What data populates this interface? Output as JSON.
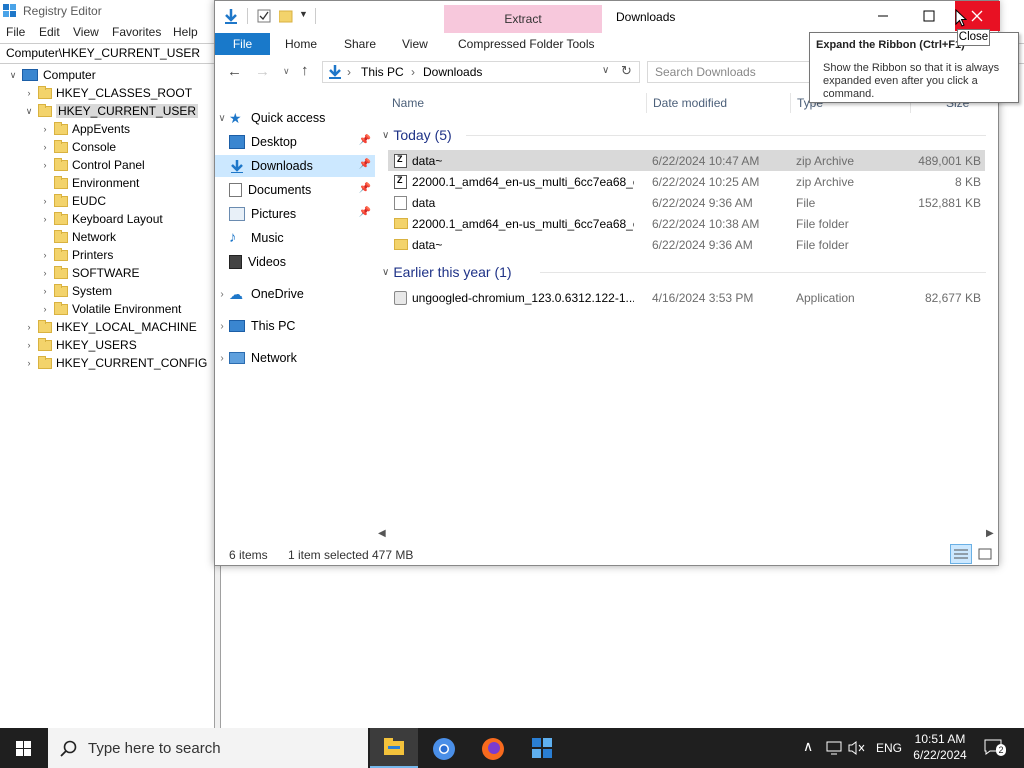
{
  "regedit": {
    "title": "Registry Editor",
    "menu": [
      "File",
      "Edit",
      "View",
      "Favorites",
      "Help"
    ],
    "address": "Computer\\HKEY_CURRENT_USER",
    "tree": {
      "computer": "Computer",
      "hkcr": "HKEY_CLASSES_ROOT",
      "hkcu": "HKEY_CURRENT_USER",
      "hkcu_children": [
        "AppEvents",
        "Console",
        "Control Panel",
        "Environment",
        "EUDC",
        "Keyboard Layout",
        "Network",
        "Printers",
        "SOFTWARE",
        "System",
        "Volatile Environment"
      ],
      "hklm": "HKEY_LOCAL_MACHINE",
      "hku": "HKEY_USERS",
      "hkcc": "HKEY_CURRENT_CONFIG"
    }
  },
  "explorer": {
    "window_title": "Downloads",
    "contextual_tab": "Extract",
    "ribbon_tabs": {
      "file": "File",
      "home": "Home",
      "share": "Share",
      "view": "View",
      "compressed": "Compressed Folder Tools"
    },
    "breadcrumb": [
      "This PC",
      "Downloads"
    ],
    "search_placeholder": "Search Downloads",
    "nav": {
      "quick_access": "Quick access",
      "desktop": "Desktop",
      "downloads": "Downloads",
      "documents": "Documents",
      "pictures": "Pictures",
      "music": "Music",
      "videos": "Videos",
      "onedrive": "OneDrive",
      "this_pc": "This PC",
      "network": "Network"
    },
    "columns": {
      "name": "Name",
      "date": "Date modified",
      "type": "Type",
      "size": "Size"
    },
    "groups": {
      "today": "Today (5)",
      "earlier": "Earlier this year (1)"
    },
    "files_today": [
      {
        "name": "data~",
        "date": "6/22/2024 10:47 AM",
        "type": "zip Archive",
        "size": "489,001 KB",
        "icon": "zip-icon"
      },
      {
        "name": "22000.1_amd64_en-us_multi_6cc7ea68_c...",
        "date": "6/22/2024 10:25 AM",
        "type": "zip Archive",
        "size": "8 KB",
        "icon": "zip-icon"
      },
      {
        "name": "data",
        "date": "6/22/2024 9:36 AM",
        "type": "File",
        "size": "152,881 KB",
        "icon": "file-icon"
      },
      {
        "name": "22000.1_amd64_en-us_multi_6cc7ea68_c...",
        "date": "6/22/2024 10:38 AM",
        "type": "File folder",
        "size": "",
        "icon": "folder-icon"
      },
      {
        "name": "data~",
        "date": "6/22/2024 9:36 AM",
        "type": "File folder",
        "size": "",
        "icon": "folder-icon"
      }
    ],
    "files_earlier": [
      {
        "name": "ungoogled-chromium_123.0.6312.122-1....",
        "date": "4/16/2024 3:53 PM",
        "type": "Application",
        "size": "82,677 KB",
        "icon": "app-icon"
      }
    ],
    "status": {
      "items": "6 items",
      "selected": "1 item selected",
      "size": "477 MB"
    }
  },
  "tooltip": {
    "title": "Expand the Ribbon (Ctrl+F1)",
    "body": "Show the Ribbon so that it is always expanded even after you click a command."
  },
  "close_tooltip": "Close",
  "taskbar": {
    "search_placeholder": "Type here to search",
    "lang": "ENG",
    "time": "10:51 AM",
    "date": "6/22/2024",
    "notification_count": "2"
  }
}
